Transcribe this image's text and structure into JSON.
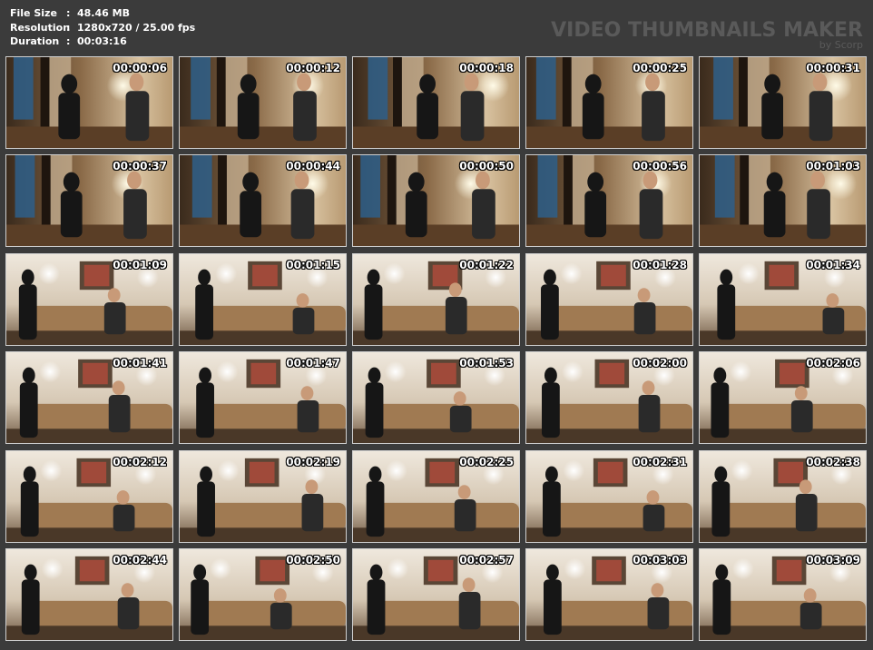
{
  "info": {
    "rows": [
      {
        "label": "File Size",
        "sep": ":",
        "value": "48.46 MB"
      },
      {
        "label": "Resolution",
        "sep": ":",
        "value": "1280x720 / 25.00 fps"
      },
      {
        "label": "Duration",
        "sep": ":",
        "value": "00:03:16"
      }
    ]
  },
  "brand": {
    "title": "VIDEO THUMBNAILS MAKER",
    "subtitle": "by Scorp"
  },
  "colors": {
    "background": "#3b3b3b",
    "border": "#cfcfcf",
    "timestamp": "#ffffff",
    "brand": "#5a5a5a"
  },
  "thumbnails": [
    {
      "time": "00:00:06",
      "scene": "hallway"
    },
    {
      "time": "00:00:12",
      "scene": "hallway"
    },
    {
      "time": "00:00:18",
      "scene": "hallway"
    },
    {
      "time": "00:00:25",
      "scene": "hallway"
    },
    {
      "time": "00:00:31",
      "scene": "hallway"
    },
    {
      "time": "00:00:37",
      "scene": "hallway"
    },
    {
      "time": "00:00:44",
      "scene": "hallway"
    },
    {
      "time": "00:00:50",
      "scene": "hallway"
    },
    {
      "time": "00:00:56",
      "scene": "hallway"
    },
    {
      "time": "00:01:03",
      "scene": "hallway"
    },
    {
      "time": "00:01:09",
      "scene": "sofa"
    },
    {
      "time": "00:01:15",
      "scene": "sofa"
    },
    {
      "time": "00:01:22",
      "scene": "sofa"
    },
    {
      "time": "00:01:28",
      "scene": "sofa"
    },
    {
      "time": "00:01:34",
      "scene": "sofa"
    },
    {
      "time": "00:01:41",
      "scene": "sofa"
    },
    {
      "time": "00:01:47",
      "scene": "sofa"
    },
    {
      "time": "00:01:53",
      "scene": "sofa"
    },
    {
      "time": "00:02:00",
      "scene": "sofa"
    },
    {
      "time": "00:02:06",
      "scene": "sofa"
    },
    {
      "time": "00:02:12",
      "scene": "sofa"
    },
    {
      "time": "00:02:19",
      "scene": "sofa"
    },
    {
      "time": "00:02:25",
      "scene": "sofa"
    },
    {
      "time": "00:02:31",
      "scene": "sofa"
    },
    {
      "time": "00:02:38",
      "scene": "sofa"
    },
    {
      "time": "00:02:44",
      "scene": "sofa"
    },
    {
      "time": "00:02:50",
      "scene": "sofa"
    },
    {
      "time": "00:02:57",
      "scene": "sofa"
    },
    {
      "time": "00:03:03",
      "scene": "sofa"
    },
    {
      "time": "00:03:09",
      "scene": "sofa"
    }
  ]
}
